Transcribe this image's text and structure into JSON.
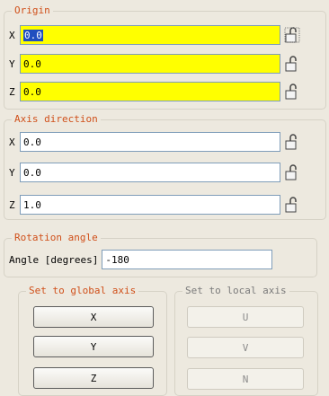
{
  "origin": {
    "legend": "Origin",
    "rows": [
      {
        "axis": "X",
        "value": "0.0"
      },
      {
        "axis": "Y",
        "value": "0.0"
      },
      {
        "axis": "Z",
        "value": "0.0"
      }
    ]
  },
  "axis_direction": {
    "legend": "Axis direction",
    "rows": [
      {
        "axis": "X",
        "value": "0.0"
      },
      {
        "axis": "Y",
        "value": "0.0"
      },
      {
        "axis": "Z",
        "value": "1.0"
      }
    ]
  },
  "rotation": {
    "legend": "Rotation angle",
    "label": "Angle [degrees]",
    "value": "-180"
  },
  "global_axis": {
    "legend": "Set to global axis",
    "buttons": [
      "X",
      "Y",
      "Z"
    ]
  },
  "local_axis": {
    "legend": "Set to local axis",
    "buttons": [
      "U",
      "V",
      "N"
    ]
  },
  "colors": {
    "legend_accent": "#d0501a",
    "highlight_field": "#ffff00",
    "selection": "#1f4fbf"
  },
  "icons": {
    "field_action": "unlock-icon"
  }
}
